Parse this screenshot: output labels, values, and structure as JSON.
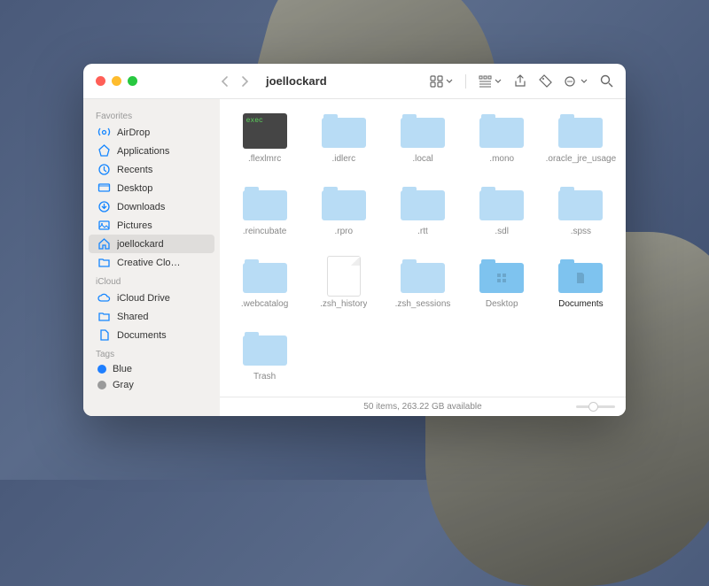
{
  "window": {
    "title": "joellockard"
  },
  "sidebar": {
    "sections": [
      {
        "header": "Favorites",
        "items": [
          {
            "icon": "airdrop",
            "label": "AirDrop"
          },
          {
            "icon": "apps",
            "label": "Applications"
          },
          {
            "icon": "recents",
            "label": "Recents"
          },
          {
            "icon": "desktop",
            "label": "Desktop"
          },
          {
            "icon": "downloads",
            "label": "Downloads"
          },
          {
            "icon": "pictures",
            "label": "Pictures"
          },
          {
            "icon": "home",
            "label": "joellockard",
            "selected": true
          },
          {
            "icon": "folder",
            "label": "Creative Clo…"
          }
        ]
      },
      {
        "header": "iCloud",
        "items": [
          {
            "icon": "icloud",
            "label": "iCloud Drive"
          },
          {
            "icon": "shared",
            "label": "Shared"
          },
          {
            "icon": "documents",
            "label": "Documents"
          }
        ]
      },
      {
        "header": "Tags",
        "items": [
          {
            "tag": "#1f7fff",
            "label": "Blue"
          },
          {
            "tag": "#9a9a9a",
            "label": "Gray"
          }
        ]
      }
    ]
  },
  "items": [
    {
      "type": "exec",
      "label": ".flexlmrc"
    },
    {
      "type": "folder",
      "label": ".idlerc"
    },
    {
      "type": "folder",
      "label": ".local"
    },
    {
      "type": "folder",
      "label": ".mono"
    },
    {
      "type": "folder",
      "label": ".oracle_jre_usage"
    },
    {
      "type": "folder",
      "label": ".reincubate"
    },
    {
      "type": "folder",
      "label": ".rpro"
    },
    {
      "type": "folder",
      "label": ".rtt"
    },
    {
      "type": "folder",
      "label": ".sdl"
    },
    {
      "type": "folder",
      "label": ".spss"
    },
    {
      "type": "folder",
      "label": ".webcatalog"
    },
    {
      "type": "file",
      "label": ".zsh_history"
    },
    {
      "type": "folder",
      "label": ".zsh_sessions"
    },
    {
      "type": "folder-sel",
      "label": "Desktop",
      "badge": "grid"
    },
    {
      "type": "folder-sel",
      "label": "Documents",
      "badge": "doc",
      "selected": true
    },
    {
      "type": "folder",
      "label": "Trash"
    }
  ],
  "status": {
    "text": "50 items, 263.22 GB available"
  }
}
